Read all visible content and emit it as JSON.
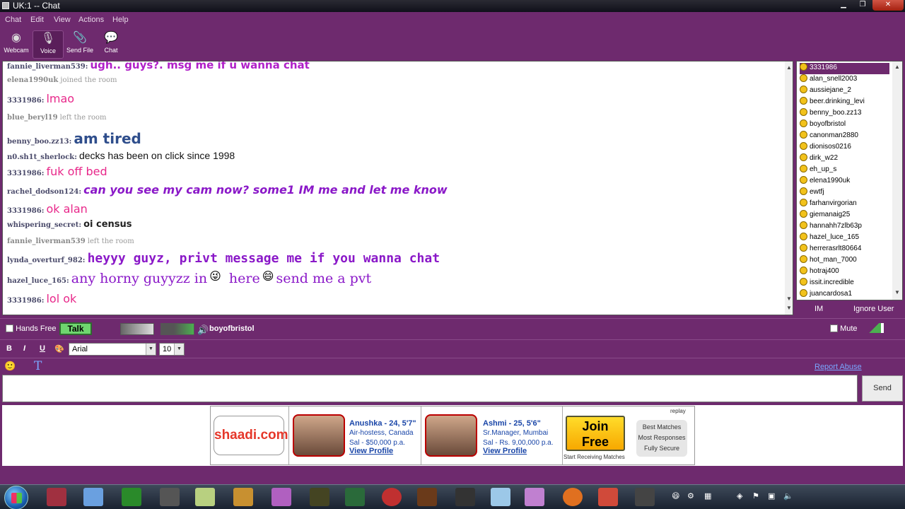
{
  "window": {
    "title": "UK:1 -- Chat"
  },
  "menu": [
    "Chat",
    "Edit",
    "View",
    "Actions",
    "Help"
  ],
  "toolbar": {
    "webcam": "Webcam",
    "voice": "Voice",
    "send_file": "Send File",
    "chat": "Chat"
  },
  "messages": [
    {
      "nick": "fannie_liverman539:",
      "text": "ugh.. guys?. msg me if u wanna chat",
      "type": "msg"
    },
    {
      "nick": "elena1990uk",
      "text": "joined the room",
      "type": "sys"
    },
    {
      "nick": "3331986:",
      "text": "lmao",
      "type": "msg"
    },
    {
      "nick": "blue_beryl19",
      "text": "left the room",
      "type": "sys"
    },
    {
      "nick": "benny_boo.zz13:",
      "text": "am tired",
      "type": "msg"
    },
    {
      "nick": "n0.sh1t_sherlock:",
      "text": "decks has been on click since 1998",
      "type": "msg"
    },
    {
      "nick": "3331986:",
      "text": "fuk off bed",
      "type": "msg"
    },
    {
      "nick": "rachel_dodson124:",
      "text": "can you see my cam now? some1 IM me and let me know",
      "type": "msg"
    },
    {
      "nick": "3331986:",
      "text": "ok alan",
      "type": "msg"
    },
    {
      "nick": "whispering_secret:",
      "text": "oi census",
      "type": "msg"
    },
    {
      "nick": "fannie_liverman539",
      "text": "left the room",
      "type": "sys"
    },
    {
      "nick": "lynda_overturf_982:",
      "text": "heyyy guyz, privt message me if you wanna chat",
      "type": "msg"
    },
    {
      "nick": "hazel_luce_165:",
      "text_a": "any horny guyyzz in",
      "text_b": "here",
      "text_c": "send me a pvt",
      "type": "msg"
    },
    {
      "nick": "3331986:",
      "text": "lol ok",
      "type": "msg"
    }
  ],
  "users": [
    "3331986",
    "alan_snell2003",
    "aussiejane_2",
    "beer.drinking_levi",
    "benny_boo.zz13",
    "boyofbristol",
    "canonman2880",
    "dionisos0216",
    "dirk_w22",
    "eh_up_s",
    "elena1990uk",
    "ewtfj",
    "farhanvirgorian",
    "giemanaig25",
    "hannahh7zlb63p",
    "hazel_luce_165",
    "herrerasrlt80664",
    "hot_man_7000",
    "hotraj400",
    "issit.incredible",
    "juancardosa1"
  ],
  "user_actions": {
    "im": "IM",
    "ignore": "Ignore User"
  },
  "voice": {
    "hands_free": "Hands Free",
    "talk": "Talk",
    "speaker": "boyofbristol",
    "mute": "Mute"
  },
  "format": {
    "font": "Arial",
    "size": "10",
    "bold": "B",
    "italic": "I",
    "underline": "U"
  },
  "report_abuse": "Report Abuse",
  "send": "Send",
  "ad": {
    "brand": "shaadi.com",
    "profile1": {
      "name": "Anushka - 24, 5'7\"",
      "job": "Air-hostess, Canada",
      "sal": "Sal - $50,000 p.a.",
      "link": "View Profile"
    },
    "profile2": {
      "name": "Ashmi - 25, 5'6\"",
      "job": "Sr.Manager, Mumbai",
      "sal": "Sal - Rs. 9,00,000 p.a.",
      "link": "View Profile"
    },
    "join": "Join Free",
    "start": "Start Receiving Matches",
    "replay": "replay",
    "bullets": [
      "Best Matches",
      "Most Responses",
      "Fully Secure"
    ]
  },
  "colors": {
    "theme": "#6e2a6e",
    "pink": "#e8288a",
    "purple": "#8a18c8",
    "blue": "#2f4e8c"
  }
}
